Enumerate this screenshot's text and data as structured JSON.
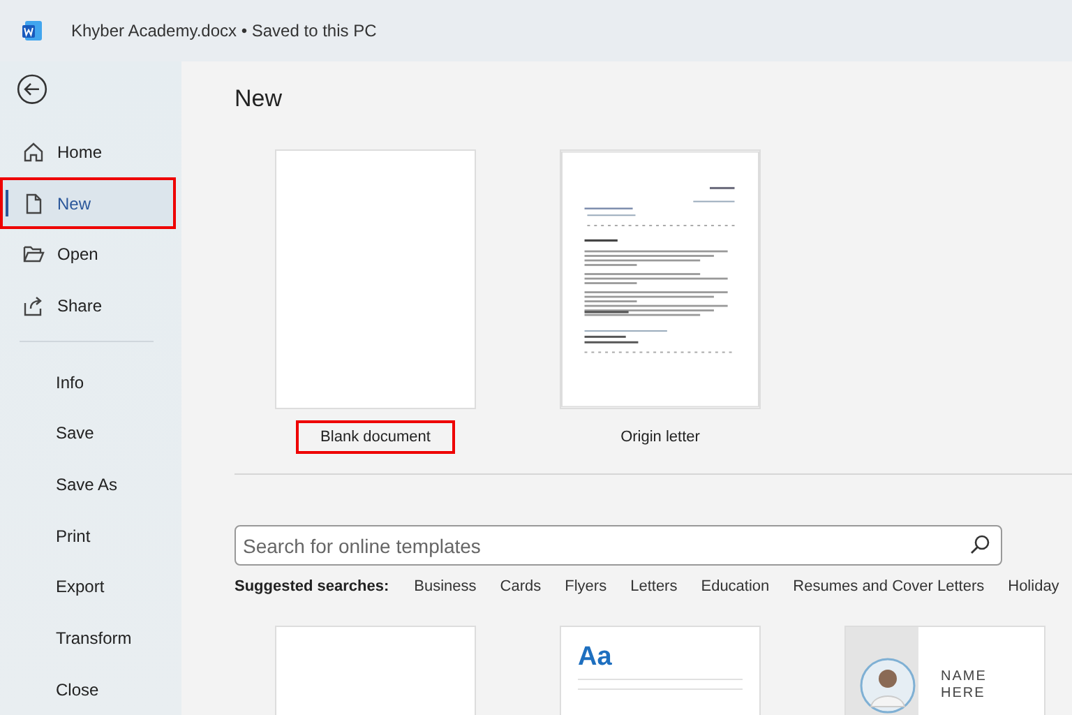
{
  "window": {
    "title": "Khyber Academy.docx  •  Saved to this PC"
  },
  "sidebar": {
    "primary": [
      {
        "label": "Home",
        "selected": false,
        "highlighted": false
      },
      {
        "label": "New",
        "selected": true,
        "highlighted": true
      },
      {
        "label": "Open",
        "selected": false,
        "highlighted": false
      },
      {
        "label": "Share",
        "selected": false,
        "highlighted": false
      }
    ],
    "secondary": [
      {
        "label": "Info"
      },
      {
        "label": "Save"
      },
      {
        "label": "Save As"
      },
      {
        "label": "Print"
      },
      {
        "label": "Export"
      },
      {
        "label": "Transform"
      },
      {
        "label": "Close"
      }
    ]
  },
  "heading": "New",
  "featured_templates": [
    {
      "kind": "blank",
      "label": "Blank document",
      "highlighted": true
    },
    {
      "kind": "letter",
      "label": "Origin letter",
      "highlighted": false
    }
  ],
  "search": {
    "placeholder": "Search for online templates"
  },
  "suggested": {
    "label": "Suggested searches:",
    "items": [
      "Business",
      "Cards",
      "Flyers",
      "Letters",
      "Education",
      "Resumes and Cover Letters",
      "Holiday"
    ]
  },
  "more_templates": [
    {
      "kind": "blank"
    },
    {
      "kind": "aa",
      "text": "Aa"
    },
    {
      "kind": "resume",
      "text": "NAME HERE"
    }
  ]
}
